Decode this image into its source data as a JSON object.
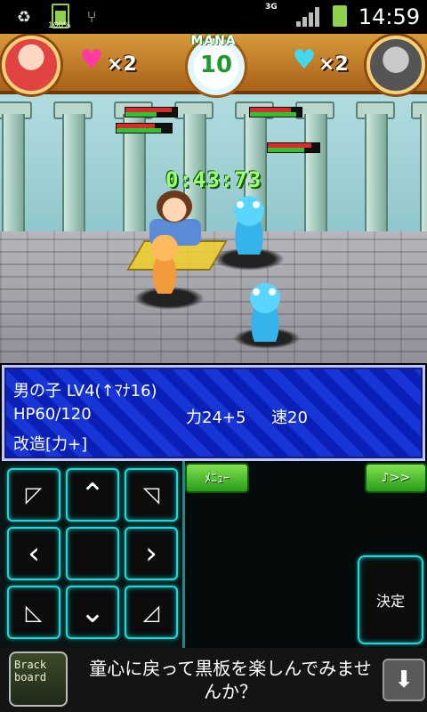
{
  "status_bar": {
    "battery_percent": "100%",
    "network": "3G",
    "time": "14:59",
    "icons": [
      "recycle-icon",
      "battery-icon",
      "usb-icon",
      "3g-icon",
      "signal-icon",
      "battery-full-icon"
    ]
  },
  "hud": {
    "left_lives": "×2",
    "right_lives": "×2",
    "mana_label": "MANA",
    "mana_value": "10",
    "left_portrait": "red-haired-girl-portrait",
    "right_portrait": "knight-helmet-portrait"
  },
  "battle": {
    "timer": "0:43:73",
    "hp_bars": [
      {
        "hp": 0.9,
        "mp": 0.6
      },
      {
        "hp": 0.7,
        "mp": 0.8
      },
      {
        "hp": 0.8,
        "mp": 0.9
      },
      {
        "hp": 0.85,
        "mp": 0.7
      }
    ],
    "units": [
      "boy",
      "teddy-bear",
      "blue-monster",
      "blue-monster"
    ]
  },
  "status_window": {
    "line1": "男の子 LV4(↑ﾏﾅ16)",
    "hp": "HP60/120",
    "strength": "力24+5",
    "speed": "速20",
    "line3": "改造[力+]"
  },
  "controls": {
    "menu_label": "ﾒﾆｭｰ",
    "sound_label": "♪>>",
    "decide_label": "決定",
    "dpad": {
      "up": "^",
      "down": "v",
      "left": "<",
      "right": ">"
    }
  },
  "ad": {
    "logo_text": "Brack board",
    "message": "童心に戻って黒板を楽しんでみませんか？",
    "download_icon": "download-icon"
  },
  "colors": {
    "status_window_bg": "#1836d8",
    "timer_green": "#9cff6c",
    "control_glow": "#2ad4d4",
    "button_green": "#2a9c1c"
  }
}
